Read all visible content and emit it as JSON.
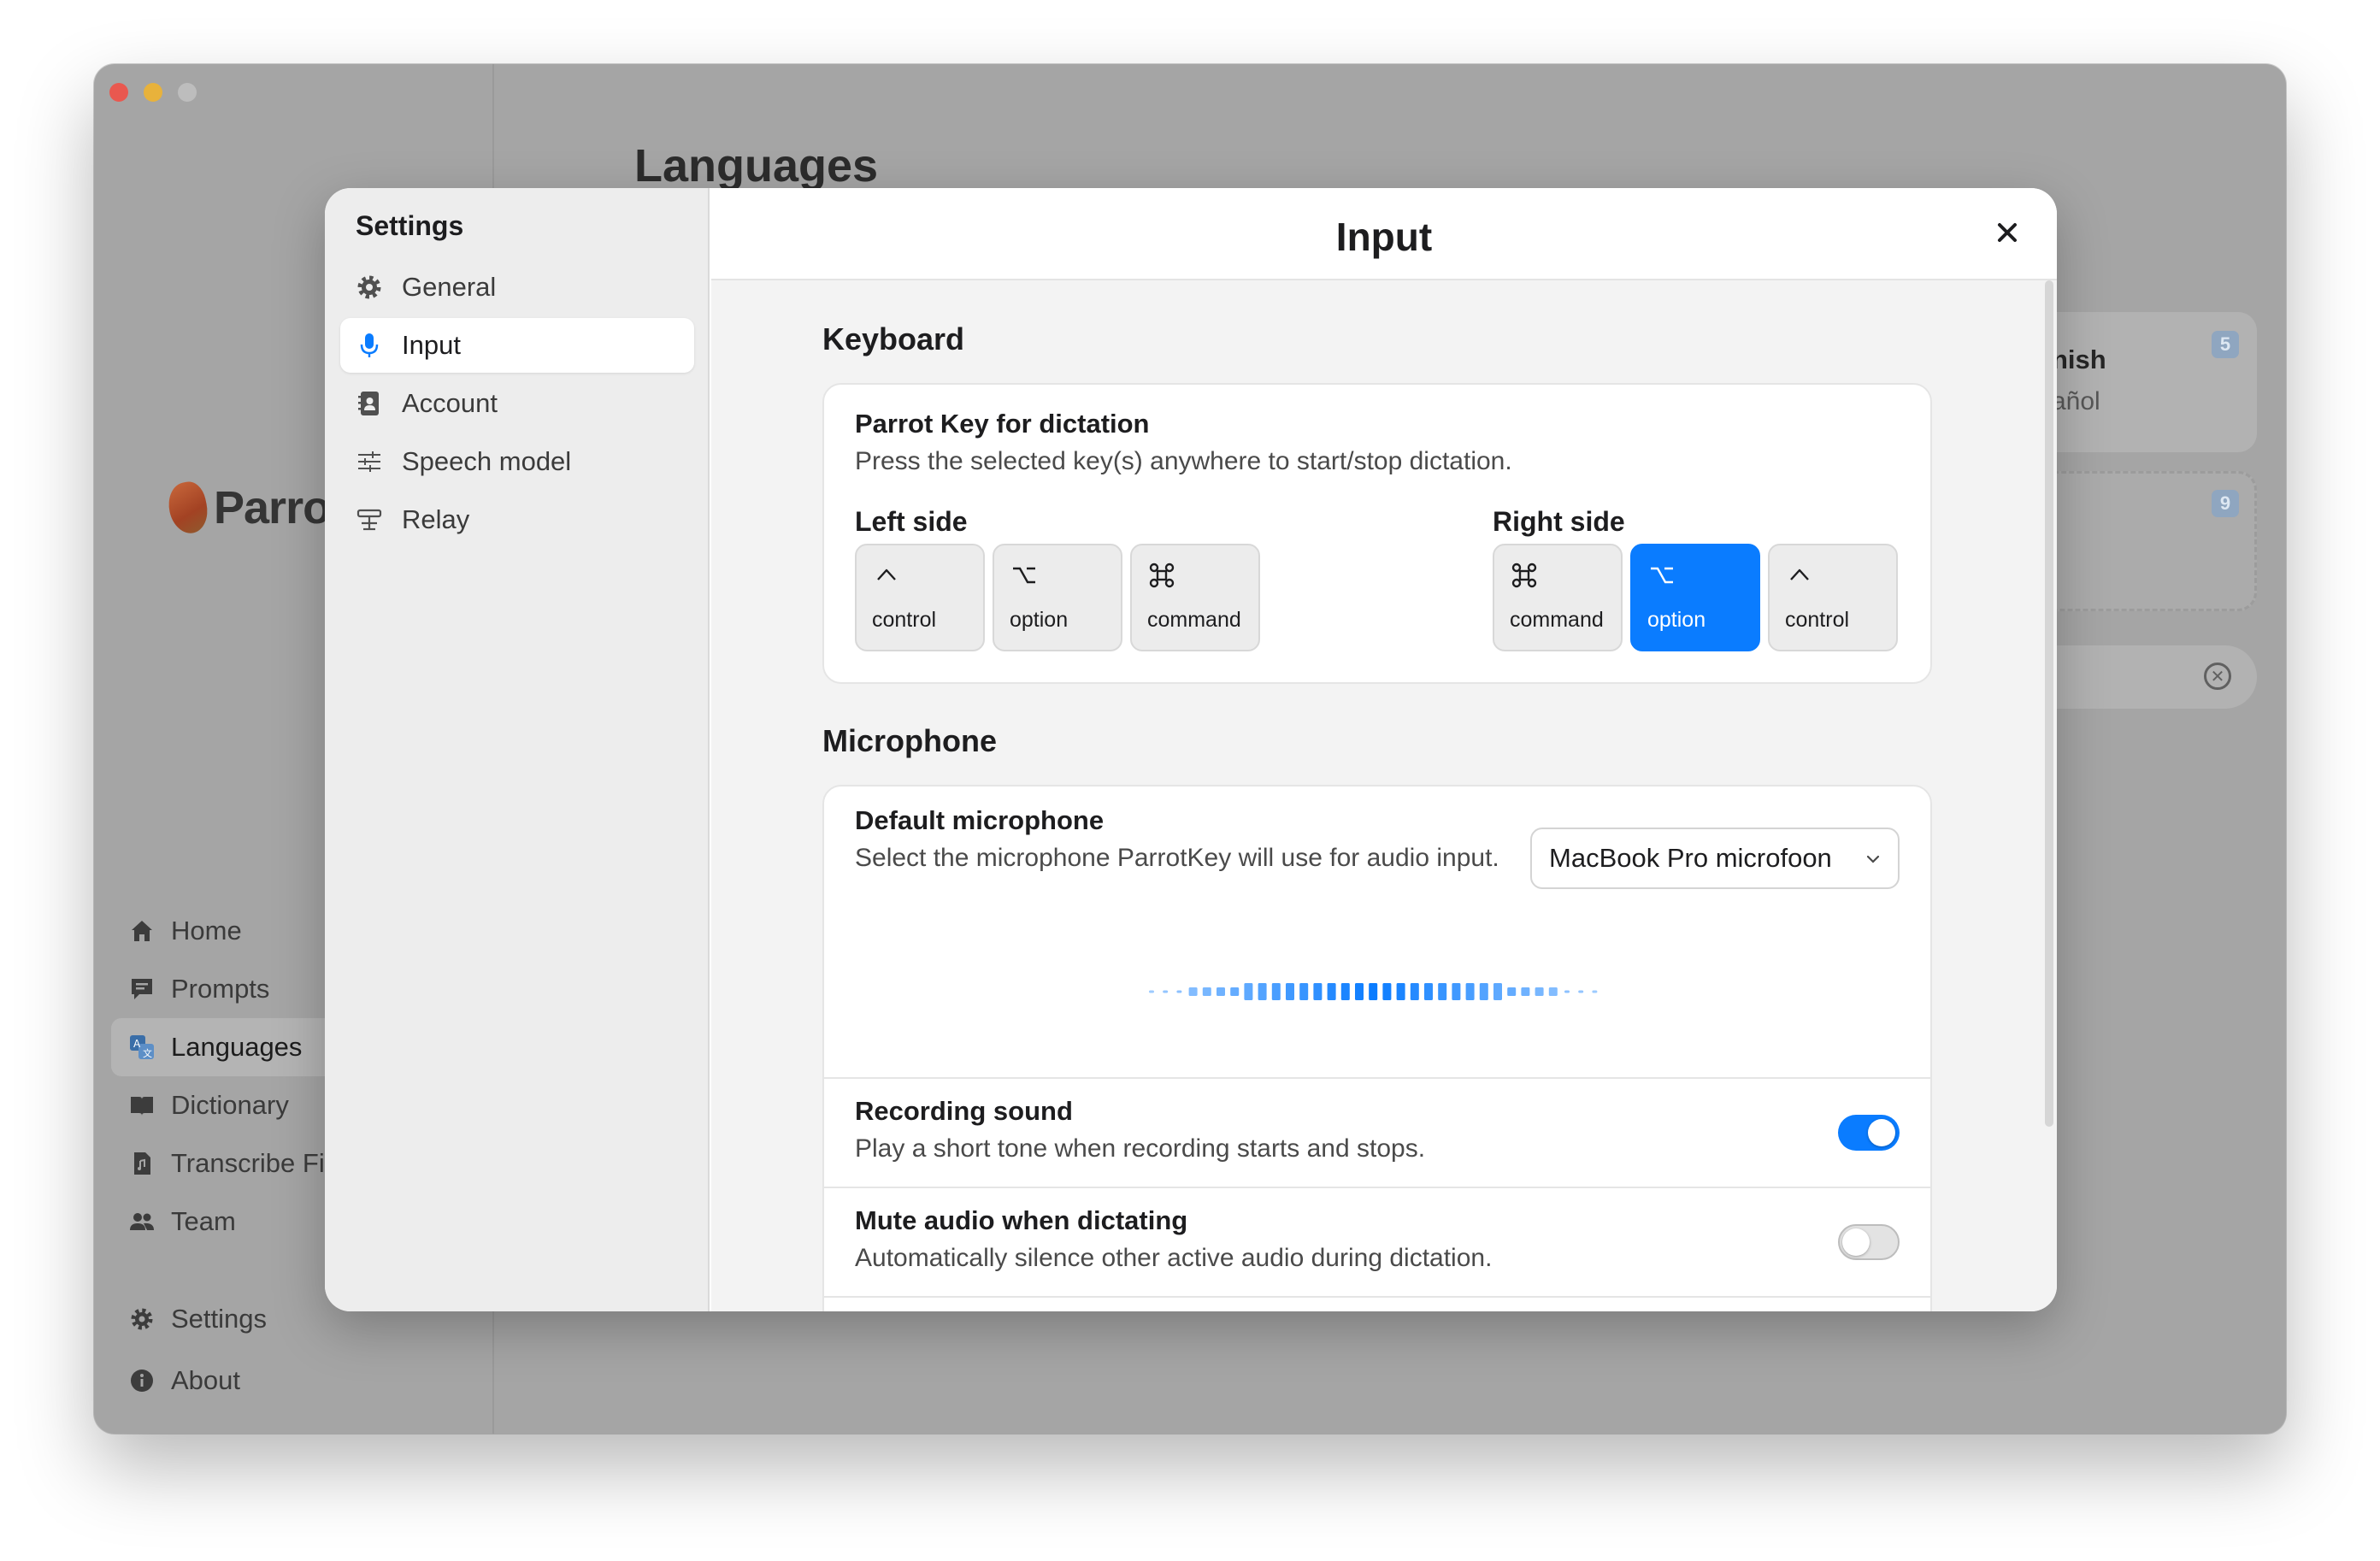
{
  "background_app": {
    "page_title": "Languages",
    "logo_text": "Parro",
    "nav": [
      {
        "label": "Home",
        "icon": "home-icon"
      },
      {
        "label": "Prompts",
        "icon": "chat-bubble-icon"
      },
      {
        "label": "Languages",
        "icon": "translate-icon",
        "active": true
      },
      {
        "label": "Dictionary",
        "icon": "book-icon"
      },
      {
        "label": "Transcribe Fi",
        "icon": "audio-file-icon"
      },
      {
        "label": "Team",
        "icon": "people-icon"
      }
    ],
    "nav_bottom": [
      {
        "label": "Settings",
        "icon": "gear-icon"
      },
      {
        "label": "About",
        "icon": "info-icon"
      }
    ],
    "cards": [
      {
        "title": "nish",
        "subtitle": "añol",
        "badge": "5"
      },
      {
        "badge": "9"
      }
    ]
  },
  "settings": {
    "title": "Settings",
    "items": [
      {
        "label": "General",
        "icon": "gear-icon"
      },
      {
        "label": "Input",
        "icon": "microphone-icon",
        "active": true
      },
      {
        "label": "Account",
        "icon": "contact-book-icon"
      },
      {
        "label": "Speech model",
        "icon": "sliders-icon"
      },
      {
        "label": "Relay",
        "icon": "relay-icon"
      }
    ]
  },
  "panel": {
    "title": "Input",
    "keyboard": {
      "heading": "Keyboard",
      "title": "Parrot Key for dictation",
      "description": "Press the selected key(s) anywhere to start/stop dictation.",
      "left_label": "Left side",
      "right_label": "Right side",
      "left_keys": [
        {
          "symbol": "control-symbol-icon",
          "label": "control",
          "selected": false
        },
        {
          "symbol": "option-symbol-icon",
          "label": "option",
          "selected": false
        },
        {
          "symbol": "command-symbol-icon",
          "label": "command",
          "selected": false
        }
      ],
      "right_keys": [
        {
          "symbol": "command-symbol-icon",
          "label": "command",
          "selected": false
        },
        {
          "symbol": "option-symbol-icon",
          "label": "option",
          "selected": true
        },
        {
          "symbol": "control-symbol-icon",
          "label": "control",
          "selected": false
        }
      ]
    },
    "microphone": {
      "heading": "Microphone",
      "title": "Default microphone",
      "description": "Select the microphone ParrotKey will use for audio input.",
      "selected_device": "MacBook Pro microfoon"
    },
    "recording_sound": {
      "title": "Recording sound",
      "description": "Play a short tone when recording starts and stops.",
      "enabled": true
    },
    "mute_audio": {
      "title": "Mute audio when dictating",
      "description": "Automatically silence other active audio during dictation.",
      "enabled": false
    }
  },
  "colors": {
    "accent": "#0a7cff",
    "modal_sidebar": "#ededed",
    "content_bg": "#f3f3f3",
    "dimmed_window": "#a5a5a5"
  }
}
